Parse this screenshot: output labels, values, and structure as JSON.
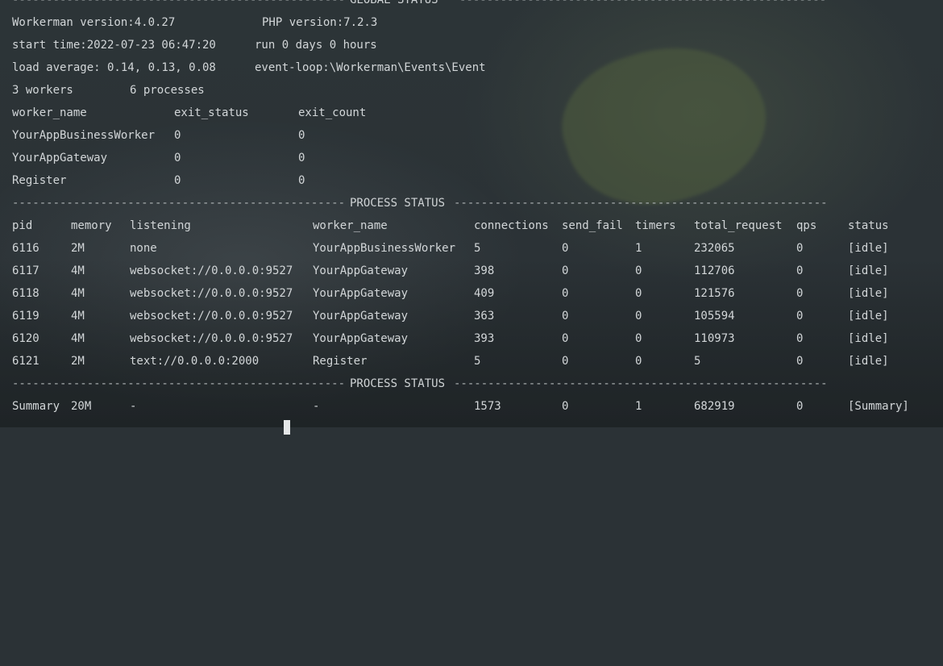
{
  "global": {
    "title": "GLOBAL STATUS",
    "workerman_version": "Workerman version:4.0.27",
    "php_version": "PHP version:7.2.3",
    "start_time": "start time:2022-07-23 06:47:20",
    "run_time": "run 0 days 0 hours",
    "load_average": "load average: 0.14, 0.13, 0.08",
    "event_loop": "event-loop:\\Workerman\\Events\\Event",
    "workers_count": "3 workers",
    "processes_count": "6 processes"
  },
  "workers_table": {
    "headers": [
      "worker_name",
      "exit_status",
      "exit_count"
    ],
    "rows": [
      [
        "YourAppBusinessWorker",
        "0",
        "0"
      ],
      [
        "YourAppGateway",
        "0",
        "0"
      ],
      [
        "Register",
        "0",
        "0"
      ]
    ]
  },
  "process": {
    "title": "PROCESS STATUS",
    "headers": [
      "pid",
      "memory",
      "listening",
      "worker_name",
      "connections",
      "send_fail",
      "timers",
      "total_request",
      "qps",
      "status"
    ],
    "rows": [
      [
        "6116",
        "2M",
        "none",
        "YourAppBusinessWorker",
        "5",
        "0",
        "1",
        "232065",
        "0",
        "[idle]"
      ],
      [
        "6117",
        "4M",
        "websocket://0.0.0.0:9527",
        "YourAppGateway",
        "398",
        "0",
        "0",
        "112706",
        "0",
        "[idle]"
      ],
      [
        "6118",
        "4M",
        "websocket://0.0.0.0:9527",
        "YourAppGateway",
        "409",
        "0",
        "0",
        "121576",
        "0",
        "[idle]"
      ],
      [
        "6119",
        "4M",
        "websocket://0.0.0.0:9527",
        "YourAppGateway",
        "363",
        "0",
        "0",
        "105594",
        "0",
        "[idle]"
      ],
      [
        "6120",
        "4M",
        "websocket://0.0.0.0:9527",
        "YourAppGateway",
        "393",
        "0",
        "0",
        "110973",
        "0",
        "[idle]"
      ],
      [
        "6121",
        "2M",
        "text://0.0.0.0:2000",
        "Register",
        "5",
        "0",
        "0",
        "5",
        "0",
        "[idle]"
      ]
    ],
    "footer_title": "PROCESS STATUS",
    "summary": [
      "Summary",
      "20M",
      "-",
      "-",
      "1573",
      "0",
      "1",
      "682919",
      "0",
      "[Summary]"
    ]
  }
}
